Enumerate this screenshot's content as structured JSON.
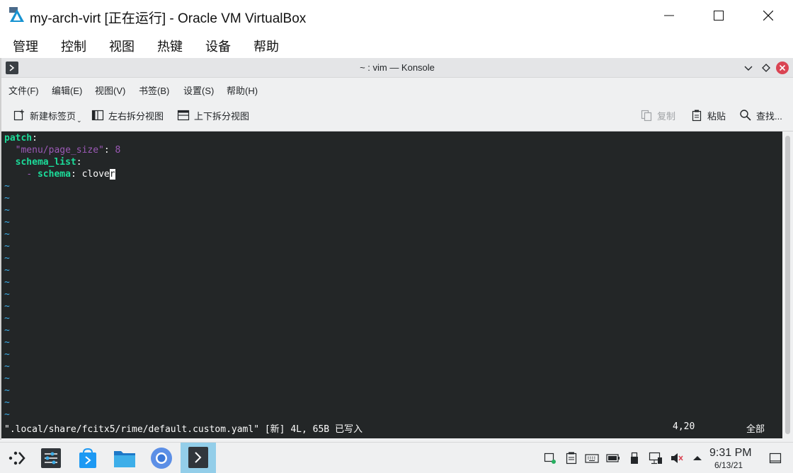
{
  "vbox": {
    "title": "my-arch-virt [正在运行] - Oracle VM VirtualBox",
    "menu": [
      "管理",
      "控制",
      "视图",
      "热键",
      "设备",
      "帮助"
    ]
  },
  "konsole": {
    "title": "~ : vim — Konsole",
    "menu": [
      "文件(F)",
      "编辑(E)",
      "视图(V)",
      "书签(B)",
      "设置(S)",
      "帮助(H)"
    ],
    "toolbar": {
      "new_tab": "新建标签页",
      "split_lr": "左右拆分视图",
      "split_tb": "上下拆分视图",
      "copy": "复制",
      "paste": "粘贴",
      "find": "查找..."
    }
  },
  "editor": {
    "line1_key": "patch",
    "line1_colon": ":",
    "line2_key": "\"menu/page_size\"",
    "line2_colon": ": ",
    "line2_value": "8",
    "line3_key": "schema_list",
    "line3_colon": ":",
    "line4_dash": "- ",
    "line4_key": "schema",
    "line4_colon": ": ",
    "line4_value": "clove",
    "line4_cursor_char": "r",
    "tilde": "~",
    "status_file": "\".local/share/fcitx5/rime/default.custom.yaml\" [新] 4L, 65B 已写入",
    "status_pos": "4,20",
    "status_all": "全部"
  },
  "clock": {
    "time": "9:31 PM",
    "date": "6/13/21"
  },
  "colors": {
    "terminal_bg": "#232627",
    "yaml_key": "#1cdc9a",
    "yaml_string": "#9b59b6",
    "tilde": "#3daee9",
    "task_active": "#93cee9"
  }
}
